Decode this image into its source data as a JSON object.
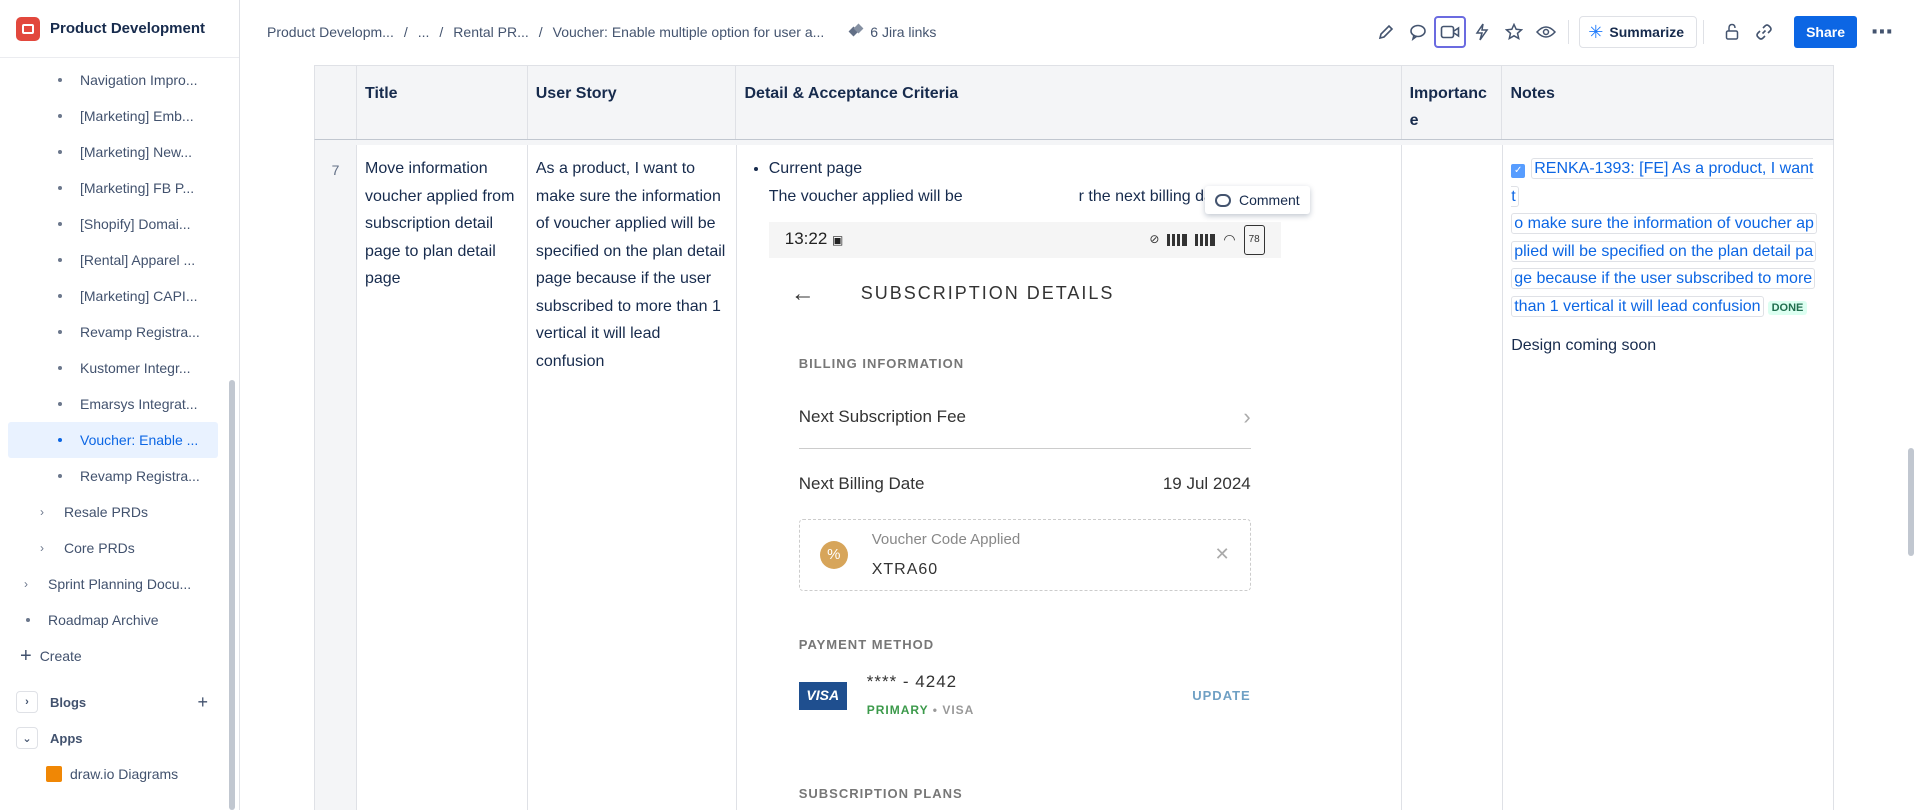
{
  "sidebar": {
    "space_name": "Product Development",
    "items": [
      {
        "label": "Navigation Impro..."
      },
      {
        "label": "[Marketing] Emb..."
      },
      {
        "label": "[Marketing] New..."
      },
      {
        "label": "[Marketing] FB P..."
      },
      {
        "label": "[Shopify] Domai..."
      },
      {
        "label": "[Rental] Apparel ..."
      },
      {
        "label": "[Marketing] CAPI..."
      },
      {
        "label": "Revamp Registra..."
      },
      {
        "label": "Kustomer Integr..."
      },
      {
        "label": "Emarsys Integrat..."
      },
      {
        "label": "Voucher: Enable ..."
      },
      {
        "label": "Revamp Registra..."
      }
    ],
    "folders": [
      {
        "label": "Resale PRDs"
      },
      {
        "label": "Core PRDs"
      }
    ],
    "top_items": [
      {
        "label": "Sprint Planning Docu..."
      },
      {
        "label": "Roadmap Archive"
      }
    ],
    "create_label": "Create",
    "blogs_label": "Blogs",
    "apps_label": "Apps",
    "drawio_label": "draw.io Diagrams"
  },
  "header": {
    "breadcrumbs": [
      "Product Developm...",
      "...",
      "Rental PR...",
      "Voucher: Enable multiple option for user a..."
    ],
    "jira_links": "6 Jira links",
    "summarize_label": "Summarize",
    "share_label": "Share"
  },
  "table": {
    "headers": [
      "Title",
      "User Story",
      "Detail & Acceptance Criteria",
      "Importance",
      "Notes"
    ],
    "row": {
      "number": "7",
      "title": "Move information voucher applied from subscription detail page to plan detail page",
      "story": "As a product, I want to make sure the information of voucher applied will be specified on the plan detail page because if the user subscribed to more than 1 vertical it will lead confusion",
      "detail_bullet": "Current page",
      "detail_text": "The voucher applied will be",
      "detail_text_after": "r the next billing date",
      "comment_label": "Comment",
      "notes_jira": "RENKA-1393: [FE] As a product, I want to make sure the information of voucher applied will be specified on the plan detail page because if the user subscribed to more than 1 vertical it will lead confusion",
      "notes_jira_lines": [
        "RENKA-1393: [FE] As a product, I want t",
        "o make sure the information of voucher ap",
        "plied will be specified on the plan detail pa",
        "ge because if the user subscribed to more",
        "than 1 vertical it will lead confusion"
      ],
      "notes_status": "DONE",
      "notes_text": "Design coming soon"
    }
  },
  "phone": {
    "time": "13:22",
    "battery": "78",
    "title": "SUBSCRIPTION DETAILS",
    "billing_label": "BILLING INFORMATION",
    "next_fee_label": "Next Subscription Fee",
    "next_billing_label": "Next Billing Date",
    "next_billing_value": "19 Jul 2024",
    "voucher_title": "Voucher Code Applied",
    "voucher_code": "XTRA60",
    "payment_label": "PAYMENT METHOD",
    "card_number": "**** - 4242",
    "card_primary": "PRIMARY",
    "card_brand": "VISA",
    "update_label": "UPDATE",
    "plans_label": "SUBSCRIPTION PLANS"
  }
}
